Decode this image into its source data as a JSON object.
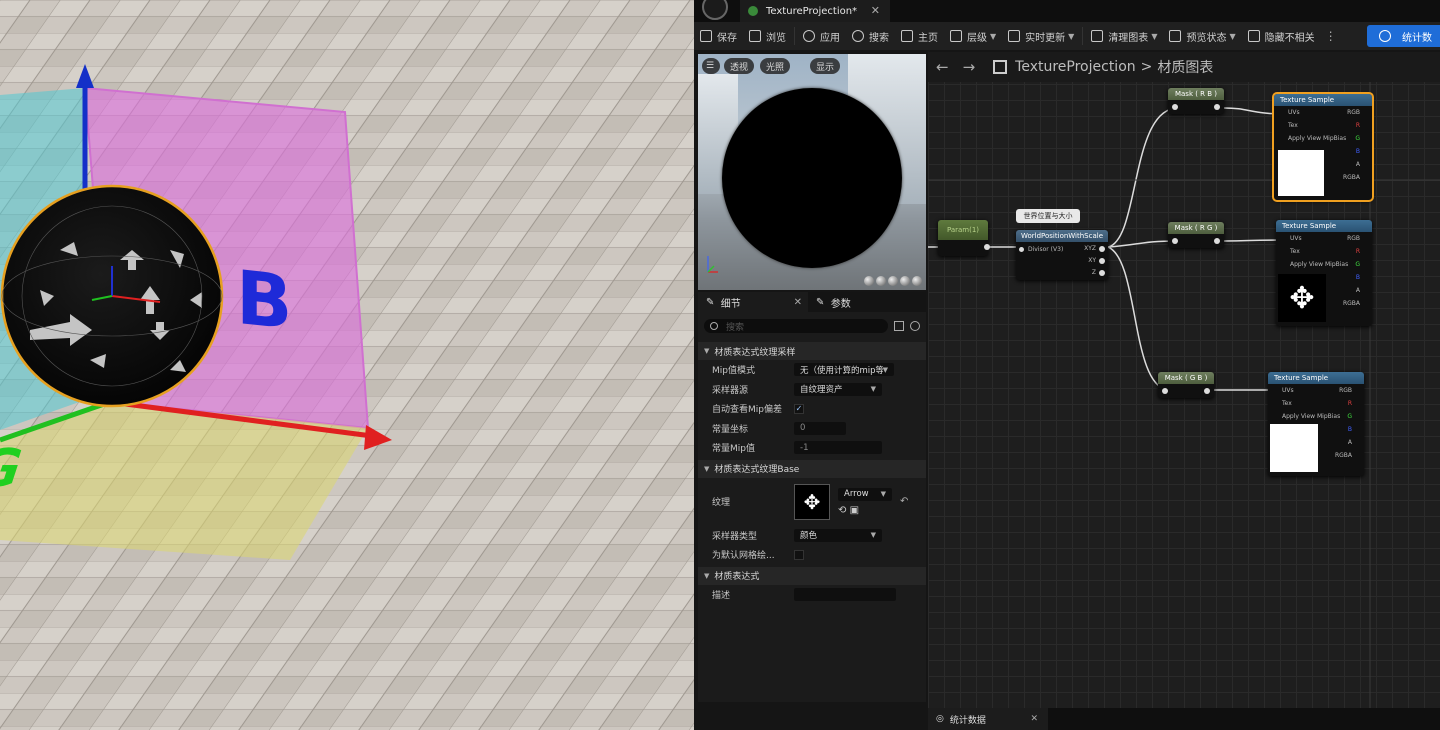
{
  "document_tab": {
    "title": "TextureProjection*"
  },
  "toolbar": {
    "save": "保存",
    "browse": "浏览",
    "apply": "应用",
    "search": "搜索",
    "home": "主页",
    "hierarchy": "层级",
    "live_update": "实时更新",
    "clean_graph": "清理图表",
    "preview_state": "预览状态",
    "hide_unrelated": "隐藏不相关",
    "stats": "统计数"
  },
  "preview": {
    "perspective": "透视",
    "lit": "光照",
    "show": "显示"
  },
  "details": {
    "tab_details": "细节",
    "tab_params": "参数",
    "search_placeholder": "搜索",
    "section_sample": "材质表达式纹理采样",
    "mip_mode_label": "Mip值模式",
    "mip_mode_value": "无（使用计算的mip等",
    "sampler_source_label": "采样器源",
    "sampler_source_value": "自纹理资产",
    "auto_mip_label": "自动查看Mip偏差",
    "const_coord_label": "常量坐标",
    "const_coord_value": "0",
    "const_mip_label": "常量Mip值",
    "const_mip_value": "-1",
    "section_base": "材质表达式纹理Base",
    "texture_label": "纹理",
    "texture_value": "Arrow",
    "sampler_type_label": "采样器类型",
    "sampler_type_value": "颜色",
    "default_mesh_label": "为默认网格绘...",
    "section_expr": "材质表达式",
    "desc_label": "描述"
  },
  "graph": {
    "back": "←",
    "forward": "→",
    "breadcrumb_asset": "TextureProjection",
    "breadcrumb_sep": ">",
    "breadcrumb_graph": "材质图表",
    "comment": "世界位置与大小",
    "param_node": "Param(1)",
    "wpws_title": "WorldPositionWithScale",
    "wpws_in": "Divisor (V3)",
    "wpws_out_xyz": "XYZ",
    "wpws_out_xy": "XY",
    "wpws_out_z": "Z",
    "mask_rb": "Mask ( R B )",
    "mask_rg": "Mask ( R G )",
    "mask_gb": "Mask ( G B )",
    "tex_sample": "Texture Sample",
    "pin_uvs": "UVs",
    "pin_tex": "Tex",
    "pin_mip": "Apply View MipBias",
    "out_rgb": "RGB",
    "out_r": "R",
    "out_g": "G",
    "out_b": "B",
    "out_a": "A",
    "out_rgba": "RGBA"
  },
  "bottom": {
    "stats_tab": "统计数据"
  },
  "viewport_labels": {
    "b": "B",
    "rg": "R G"
  },
  "colors": {
    "accent_blue": "#1f6dd8",
    "selected_node": "#f0a020",
    "mask_header": "#5a6a4a",
    "tex_header": "#3d6e93"
  }
}
